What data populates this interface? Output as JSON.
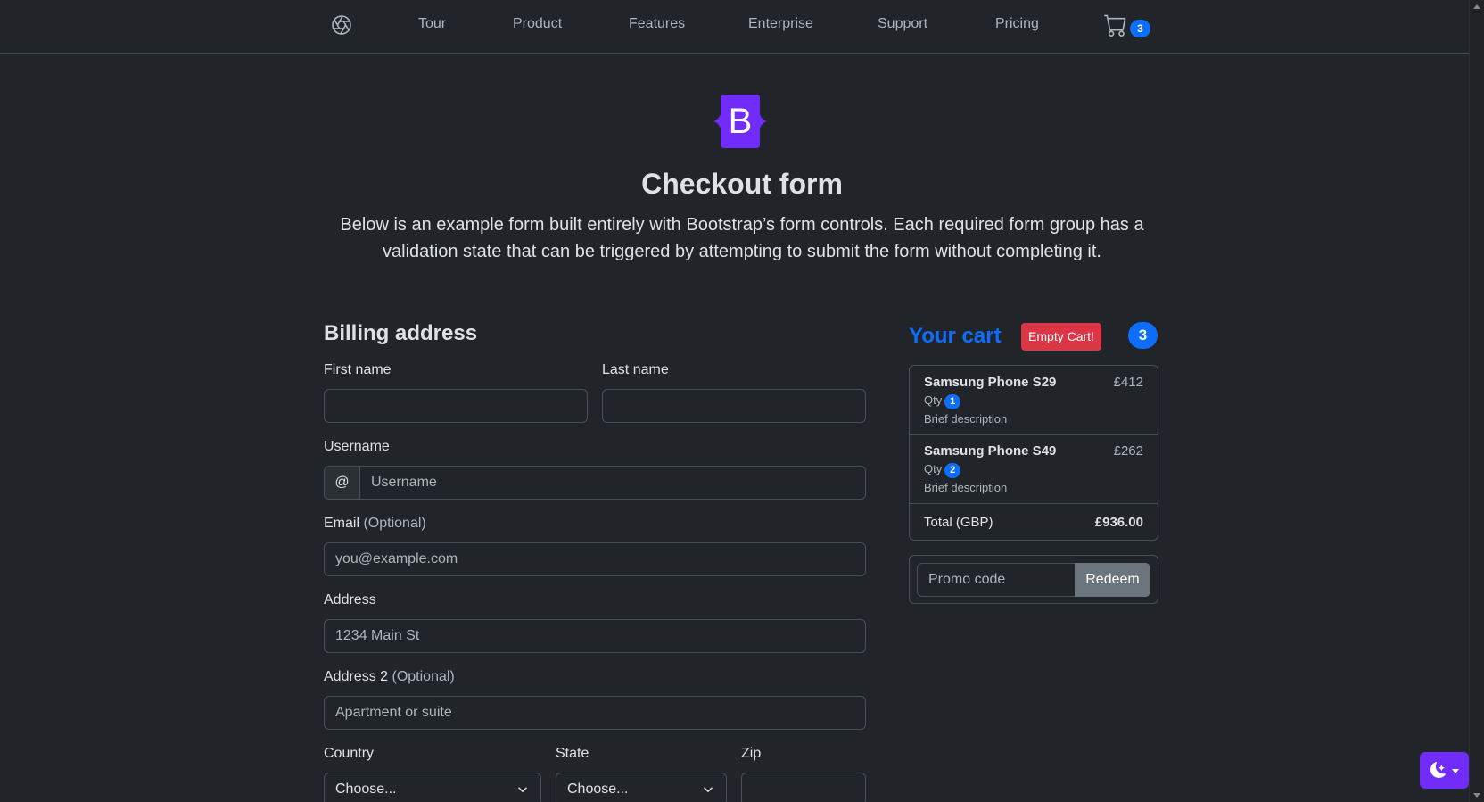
{
  "nav": {
    "logo_icon": "aperture-icon",
    "links": [
      "Tour",
      "Product",
      "Features",
      "Enterprise",
      "Support",
      "Pricing"
    ],
    "cart_icon": "cart-icon",
    "cart_count": "3"
  },
  "hero": {
    "logo_letter": "B",
    "title": "Checkout form",
    "lead": "Below is an example form built entirely with Bootstrap’s form controls. Each required form group has a validation state that can be triggered by attempting to submit the form without completing it."
  },
  "billing": {
    "title": "Billing address",
    "first_name_label": "First name",
    "first_name_value": "",
    "last_name_label": "Last name",
    "last_name_value": "",
    "username_label": "Username",
    "username_prefix": "@",
    "username_placeholder": "Username",
    "email_label": "Email",
    "email_optional": "(Optional)",
    "email_placeholder": "you@example.com",
    "address_label": "Address",
    "address_placeholder": "1234 Main St",
    "address2_label": "Address 2",
    "address2_optional": "(Optional)",
    "address2_placeholder": "Apartment or suite",
    "country_label": "Country",
    "country_value": "Choose...",
    "state_label": "State",
    "state_value": "Choose...",
    "zip_label": "Zip",
    "zip_value": ""
  },
  "cart": {
    "title": "Your cart",
    "empty_button": "Empty Cart!",
    "count": "3",
    "items": [
      {
        "name": "Samsung Phone S29",
        "price": "£412",
        "qty_label": "Qty",
        "qty": "1",
        "description": "Brief description"
      },
      {
        "name": "Samsung Phone S49",
        "price": "£262",
        "qty_label": "Qty",
        "qty": "2",
        "description": "Brief description"
      }
    ],
    "total_label": "Total (GBP)",
    "total_value": "£936.00",
    "promo_placeholder": "Promo code",
    "redeem_button": "Redeem"
  },
  "theme_toggle": {
    "icon": "moon-stars-icon"
  },
  "colors": {
    "background": "#212529",
    "primary": "#0d6efd",
    "danger": "#dc3545",
    "secondary": "#6c757d",
    "brand_purple": "#712cf9"
  }
}
